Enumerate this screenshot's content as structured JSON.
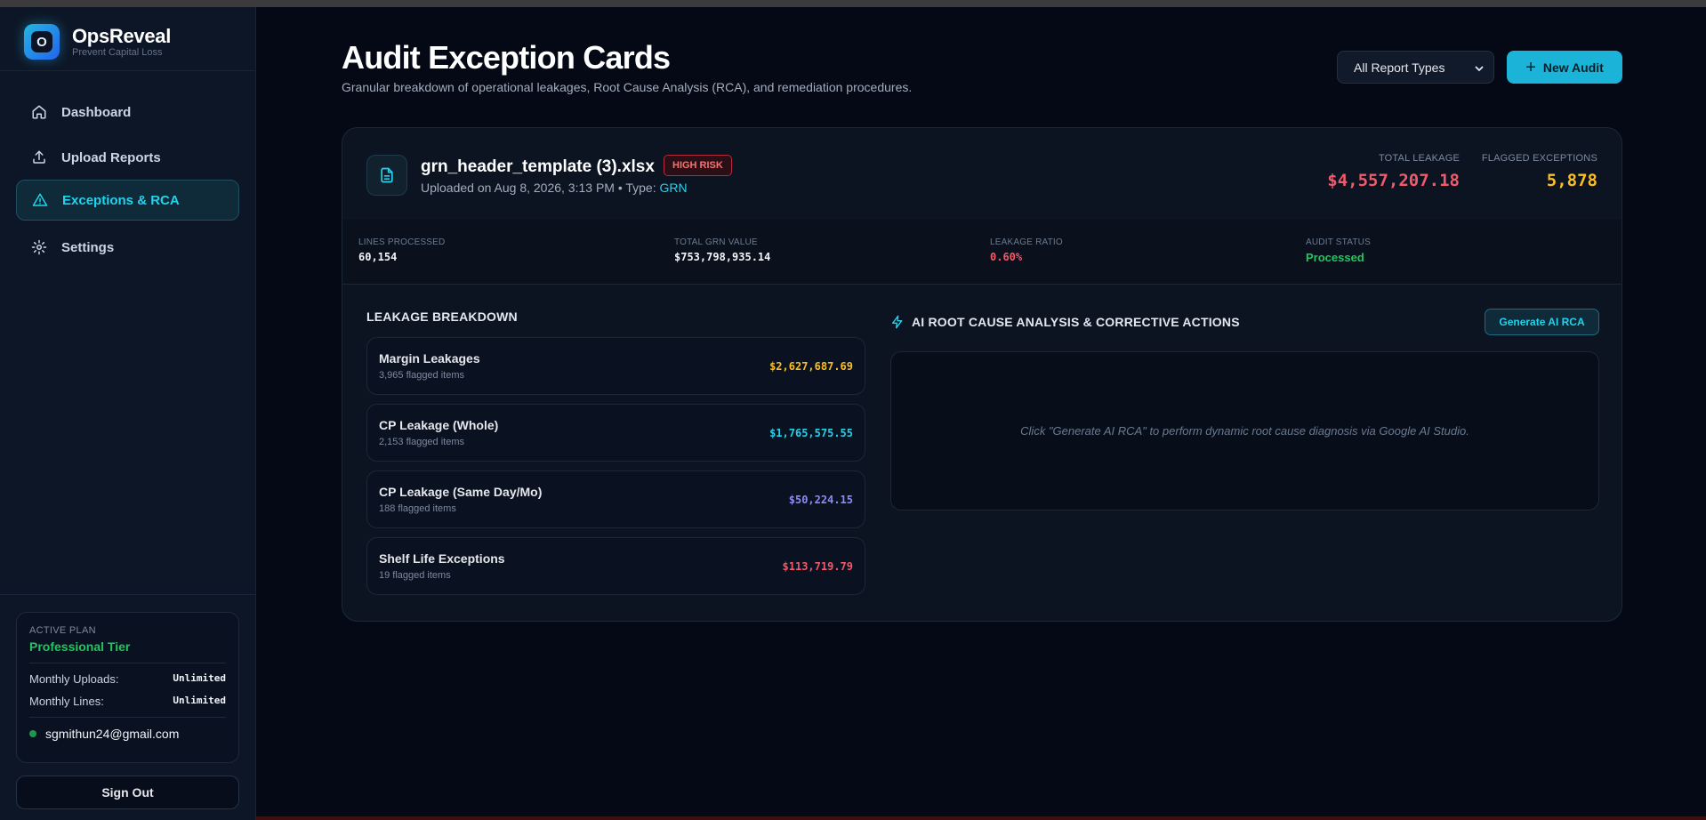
{
  "brand": {
    "logo_letter": "O",
    "name": "OpsReveal",
    "tagline": "Prevent Capital Loss"
  },
  "nav": [
    {
      "label": "Dashboard",
      "icon": "home-icon",
      "active": false
    },
    {
      "label": "Upload Reports",
      "icon": "upload-icon",
      "active": false
    },
    {
      "label": "Exceptions & RCA",
      "icon": "warning-triangle-icon",
      "active": true
    },
    {
      "label": "Settings",
      "icon": "gear-icon",
      "active": false
    }
  ],
  "plan": {
    "label": "ACTIVE PLAN",
    "tier": "Professional Tier",
    "uploads_label": "Monthly Uploads:",
    "uploads_value": "Unlimited",
    "lines_label": "Monthly Lines:",
    "lines_value": "Unlimited",
    "user_email": "sgmithun24@gmail.com"
  },
  "signout_label": "Sign Out",
  "header": {
    "title": "Audit Exception Cards",
    "subtitle": "Granular breakdown of operational leakages, Root Cause Analysis (RCA), and remediation procedures.",
    "filter_selected": "All Report Types",
    "new_audit_label": "New Audit"
  },
  "audit": {
    "file_name": "grn_header_template (3).xlsx",
    "risk_badge": "HIGH RISK",
    "uploaded_prefix": "Uploaded on Aug 8, 2026, 3:13 PM • Type:",
    "type": "GRN",
    "total_leakage_label": "TOTAL LEAKAGE",
    "total_leakage_value": "$4,557,207.18",
    "flagged_label": "FLAGGED EXCEPTIONS",
    "flagged_value": "5,878",
    "metrics": [
      {
        "label": "LINES PROCESSED",
        "value": "60,154"
      },
      {
        "label": "TOTAL GRN VALUE",
        "value": "$753,798,935.14"
      },
      {
        "label": "LEAKAGE RATIO",
        "value": "0.60%"
      },
      {
        "label": "AUDIT STATUS",
        "value": "Processed"
      }
    ],
    "breakdown_title": "LEAKAGE BREAKDOWN",
    "breakdown": [
      {
        "name": "Margin Leakages",
        "count": "3,965 flagged items",
        "value": "$2,627,687.69"
      },
      {
        "name": "CP Leakage (Whole)",
        "count": "2,153 flagged items",
        "value": "$1,765,575.55"
      },
      {
        "name": "CP Leakage (Same Day/Mo)",
        "count": "188 flagged items",
        "value": "$50,224.15"
      },
      {
        "name": "Shelf Life Exceptions",
        "count": "19 flagged items",
        "value": "$113,719.79"
      }
    ],
    "ai_title": "AI ROOT CAUSE ANALYSIS & CORRECTIVE ACTIONS",
    "generate_label": "Generate AI RCA",
    "ai_placeholder": "Click \"Generate AI RCA\" to perform dynamic root cause diagnosis via Google AI Studio."
  },
  "colors": {
    "accent": "#22d3ee",
    "danger": "#f05a6a",
    "warning": "#fbbf24",
    "success": "#22c55e",
    "cyan_value": "#22d3ee",
    "violet_value": "#8b8cf6"
  }
}
